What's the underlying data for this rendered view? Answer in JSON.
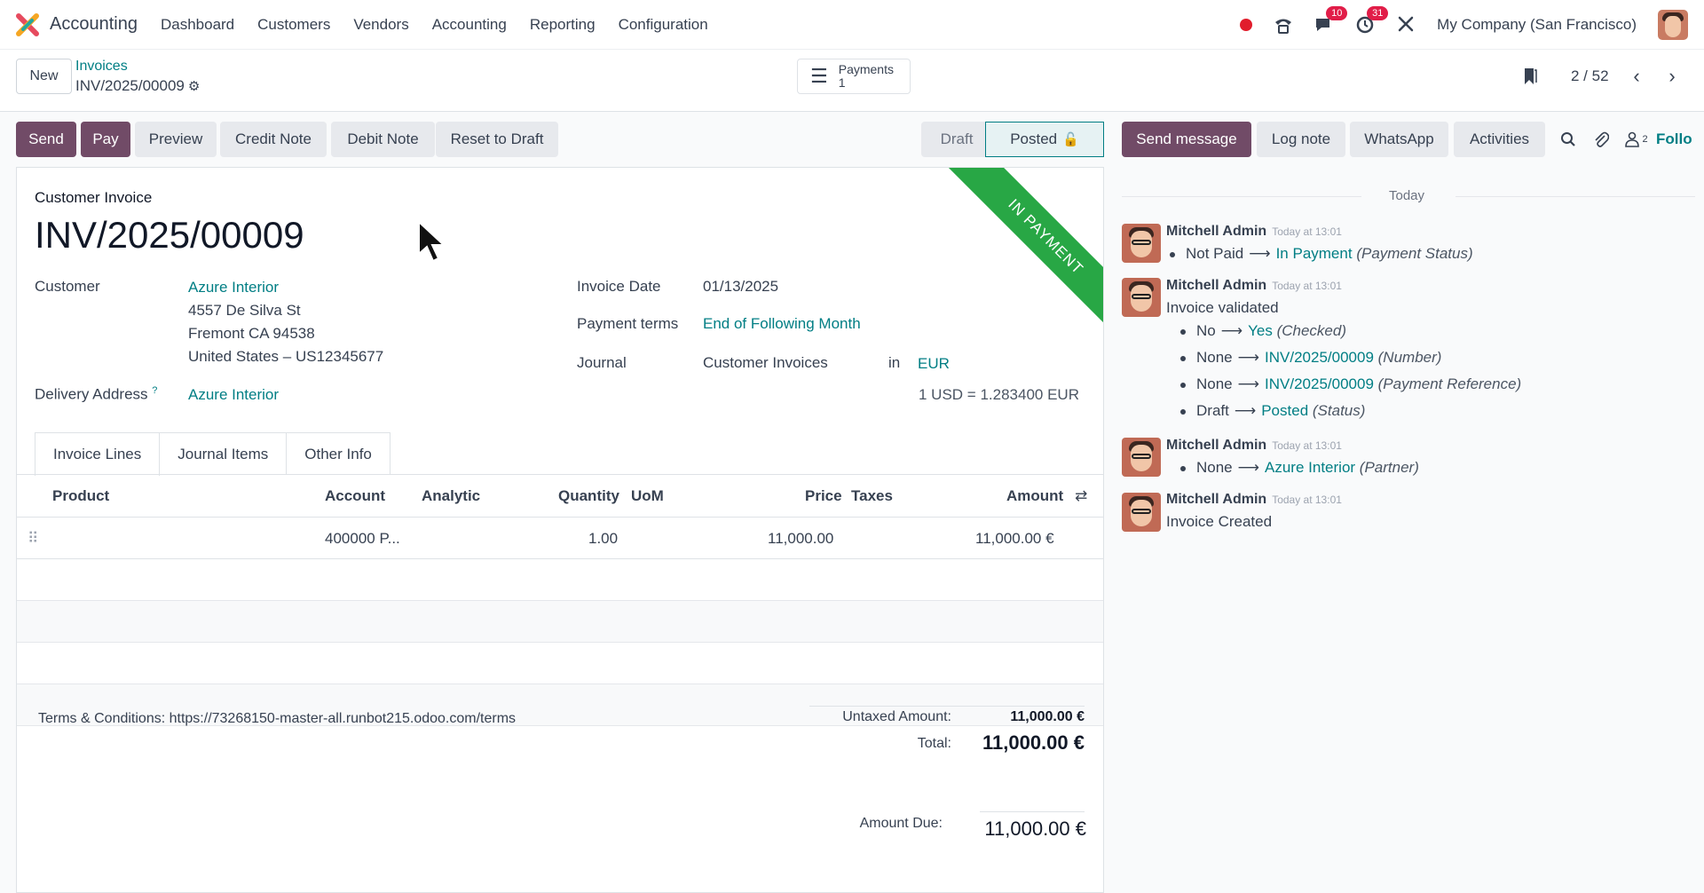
{
  "app": {
    "name": "Accounting"
  },
  "menu": [
    "Dashboard",
    "Customers",
    "Vendors",
    "Accounting",
    "Reporting",
    "Configuration"
  ],
  "topbar": {
    "messages_badge": "10",
    "activities_badge": "31",
    "company": "My Company (San Francisco)"
  },
  "control": {
    "new_label": "New",
    "breadcrumb_parent": "Invoices",
    "breadcrumb_current": "INV/2025/00009",
    "payments_label": "Payments",
    "payments_count": "1",
    "pager": "2 / 52"
  },
  "actions": {
    "send": "Send",
    "pay": "Pay",
    "preview": "Preview",
    "credit_note": "Credit Note",
    "debit_note": "Debit Note",
    "reset": "Reset to Draft"
  },
  "status": {
    "draft": "Draft",
    "posted": "Posted"
  },
  "chatter_actions": {
    "send_message": "Send message",
    "log_note": "Log note",
    "whatsapp": "WhatsApp",
    "activities": "Activities",
    "followers_count": "2",
    "follow": "Follo"
  },
  "invoice": {
    "ribbon": "IN PAYMENT",
    "type_label": "Customer Invoice",
    "name": "INV/2025/00009",
    "customer_label": "Customer",
    "customer": "Azure Interior",
    "address_1": "4557 De Silva St",
    "address_2": "Fremont CA 94538",
    "address_3": "United States – US12345677",
    "delivery_label": "Delivery Address",
    "delivery_help": "?",
    "delivery": "Azure Interior",
    "date_label": "Invoice Date",
    "date": "01/13/2025",
    "terms_label": "Payment terms",
    "terms": "End of Following Month",
    "journal_label": "Journal",
    "journal": "Customer Invoices",
    "in_label": "in",
    "currency": "EUR",
    "rate": "1 USD = 1.283400 EUR"
  },
  "tabs": [
    "Invoice Lines",
    "Journal Items",
    "Other Info"
  ],
  "lines": {
    "headers": {
      "product": "Product",
      "account": "Account",
      "analytic": "Analytic",
      "quantity": "Quantity",
      "uom": "UoM",
      "price": "Price",
      "taxes": "Taxes",
      "amount": "Amount"
    },
    "rows": [
      {
        "product": "",
        "account": "400000 P...",
        "quantity": "1.00",
        "price": "11,000.00",
        "amount": "11,000.00 €"
      }
    ]
  },
  "footer": {
    "terms": "Terms & Conditions: https://73268150-master-all.runbot215.odoo.com/terms",
    "untaxed_label": "Untaxed Amount:",
    "untaxed": "11,000.00 €",
    "total_label": "Total:",
    "total": "11,000.00 €",
    "due_label": "Amount Due:",
    "due": "11,000.00 €"
  },
  "chatter": {
    "today": "Today",
    "messages": [
      {
        "author": "Mitchell Admin",
        "time": "Today at 13:01",
        "changes": [
          {
            "from": "Not Paid",
            "to": "In Payment",
            "field": "(Payment Status)"
          }
        ]
      },
      {
        "author": "Mitchell Admin",
        "time": "Today at 13:01",
        "body": "Invoice validated",
        "changes": [
          {
            "from": "No",
            "to": "Yes",
            "field": "(Checked)"
          },
          {
            "from": "None",
            "to": "INV/2025/00009",
            "field": "(Number)"
          },
          {
            "from": "None",
            "to": "INV/2025/00009",
            "field": "(Payment Reference)"
          },
          {
            "from": "Draft",
            "to": "Posted",
            "field": "(Status)"
          }
        ]
      },
      {
        "author": "Mitchell Admin",
        "time": "Today at 13:01",
        "changes": [
          {
            "from": "None",
            "to": "Azure Interior",
            "field": "(Partner)"
          }
        ]
      },
      {
        "author": "Mitchell Admin",
        "time": "Today at 13:01",
        "body": "Invoice Created"
      }
    ]
  },
  "colors": {
    "primary": "#714b67",
    "link": "#017e84",
    "ribbon": "#28a745",
    "badge": "#e11d48"
  }
}
